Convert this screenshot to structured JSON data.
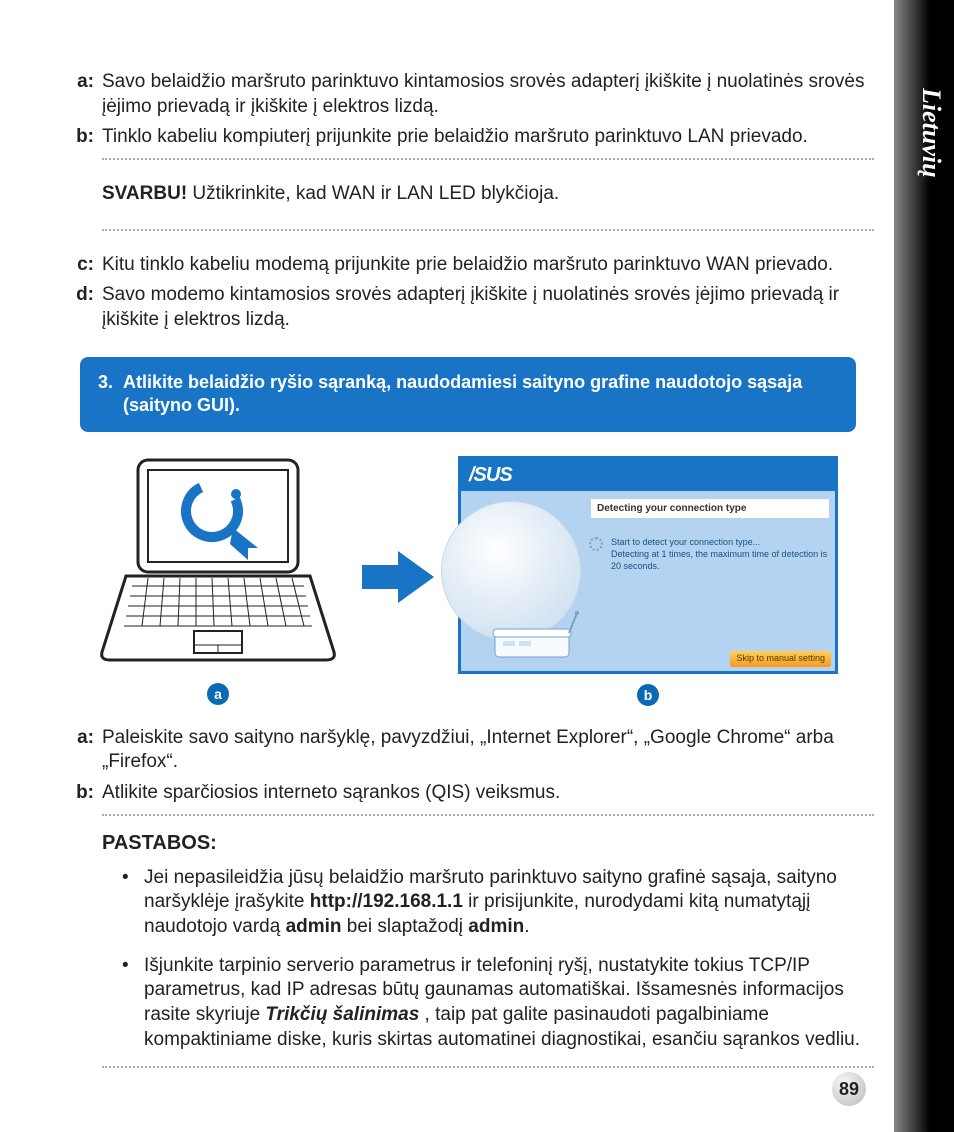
{
  "sideTab": "Lietuvių",
  "pageNumber": "89",
  "steps_abcd": {
    "a": {
      "key": "a:",
      "text": "Savo belaidžio maršruto parinktuvo kintamosios srovės adapterį įkiškite į nuolatinės srovės įėjimo prievadą ir įkiškite į elektros lizdą."
    },
    "b": {
      "key": "b:",
      "text": "Tinklo kabeliu kompiuterį prijunkite prie belaidžio maršruto parinktuvo LAN prievado."
    },
    "c": {
      "key": "c:",
      "text": "Kitu tinklo kabeliu modemą prijunkite prie belaidžio maršruto parinktuvo WAN prievado."
    },
    "d": {
      "key": "d:",
      "text_before": "Savo modemo kintamosios srovės adapterį įkiškite į nuolatinės srovės įėjimo prievadą",
      "text_after": " ir įkiškite į elektros lizdą."
    }
  },
  "svarbu": {
    "label": "SVARBU!",
    "text": "  Užtikrinkite, kad WAN ir LAN LED blykčioja."
  },
  "banner": {
    "num": "3.",
    "text": "Atlikite belaidžio ryšio sąranką, naudodamiesi saityno grafine naudotojo sąsaja (saityno GUI)."
  },
  "circles": {
    "a": "a",
    "b": "b"
  },
  "gui": {
    "logo": "/SUS",
    "header": "Detecting your connection type",
    "line1": "Start to detect your connection type...",
    "line2": "Detecting at 1 times, the maximum time of detection is 20 seconds.",
    "skip": "Skip to manual setting"
  },
  "steps_ab": {
    "a": {
      "key": "a:",
      "text": "Paleiskite savo saityno naršyklę, pavyzdžiui, „Internet Explorer“, „Google Chrome“ arba „Firefox“."
    },
    "b": {
      "key": "b:",
      "text": "Atlikite sparčiosios interneto sąrankos (QIS) veiksmus."
    }
  },
  "notes": {
    "title": "PASTABOS:",
    "n1": {
      "p1": "Jei nepasileidžia jūsų belaidžio maršruto parinktuvo saityno grafinė sąsaja, saityno",
      "p2": " naršyklėje įrašykite ",
      "url": "http://192.168.1.1",
      "p3": " ir prisijunkite, nurodydami kitą numatytąjį naudotojo vardą ",
      "u1": "admin",
      "p4": " bei slaptažodį ",
      "u2": "admin",
      "p5": "."
    },
    "n2": {
      "p1": "Išjunkite tarpinio serverio parametrus ir telefoninį ryšį, nustatykite tokius TCP/IP",
      "p2": " parametrus, kad IP adresas būtų gaunamas automatiškai. Išsamesnės informacijos rasite skyriuje ",
      "em": "Trikčių šalinimas",
      "p3": " , taip pat galite pasinaudoti pagalbiniame kompaktiniame diske, kuris skirtas automatinei diagnostikai, esančiu sąrankos vedliu."
    }
  }
}
